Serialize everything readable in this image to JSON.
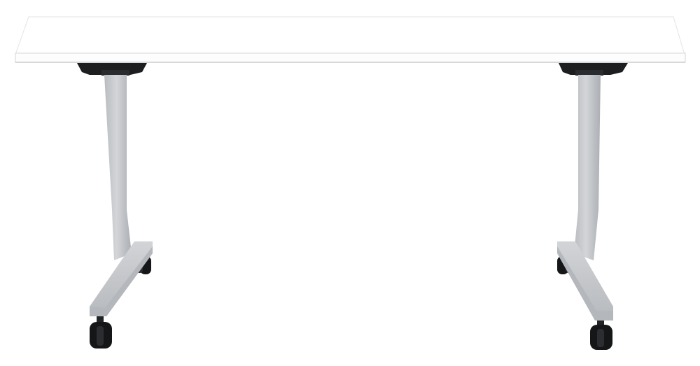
{
  "image": {
    "subject": "table",
    "object_parts": [
      "table-top",
      "left-leg",
      "right-leg",
      "left-caster-front",
      "left-caster-back",
      "right-caster-front",
      "right-caster-back"
    ],
    "colors": {
      "background": "#ffffff",
      "tabletop": "#ffffff",
      "tabletop_edge": "#d9dadc",
      "leg": "#c8cacd",
      "leg_shadow": "#aeb1b5",
      "mount": "#1d1e20",
      "caster": "#151617"
    }
  }
}
